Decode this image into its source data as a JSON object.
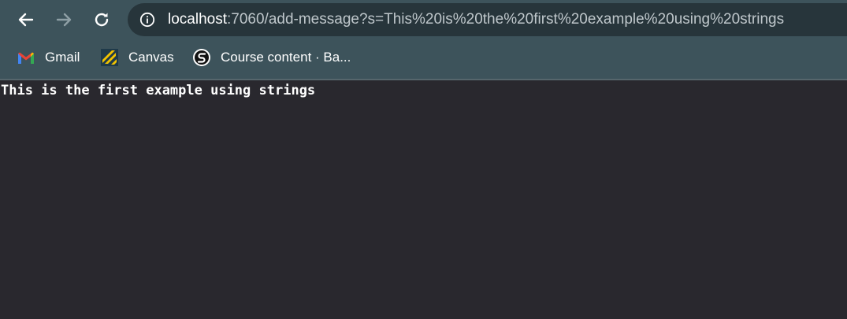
{
  "browser": {
    "nav": {
      "back_icon": "arrow-left-icon",
      "forward_icon": "arrow-right-icon",
      "reload_icon": "reload-icon"
    },
    "address_bar": {
      "info_icon": "info-icon",
      "host": "localhost",
      "rest": ":7060/add-message?s=This%20is%20the%20first%20example%20using%20strings"
    },
    "bookmarks": [
      {
        "label": "Gmail",
        "icon": "gmail-icon"
      },
      {
        "label": "Canvas",
        "icon": "canvas-icon"
      },
      {
        "label": "Course content · Ba...",
        "icon": "course-site-icon"
      }
    ],
    "colors": {
      "toolbar": "#3d535b",
      "omnibox": "#27353b",
      "page_background": "#29282e",
      "text": "#ffffff"
    }
  },
  "page": {
    "message": "This is the first example using strings"
  }
}
